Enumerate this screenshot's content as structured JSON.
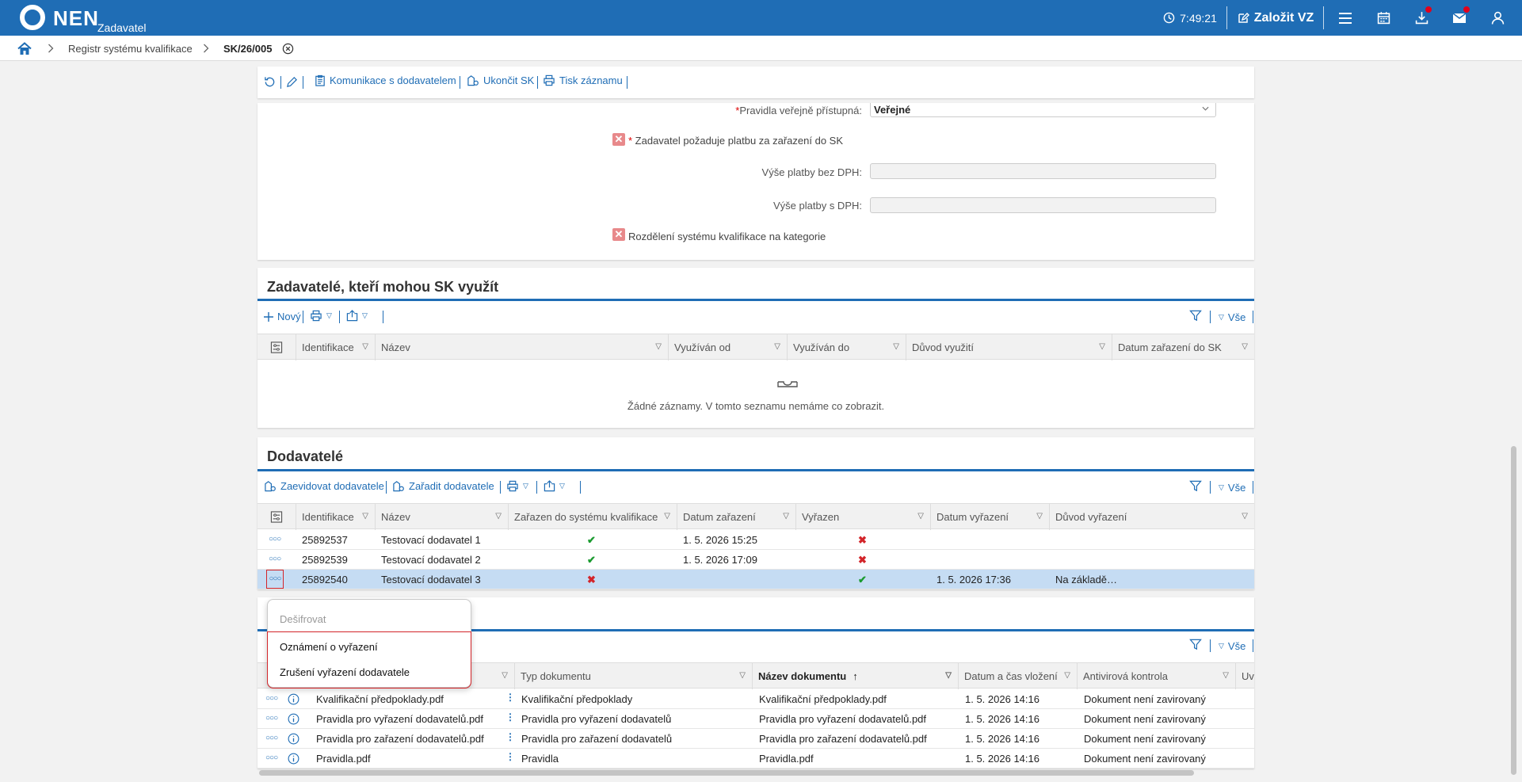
{
  "header": {
    "brand": "NEN",
    "role": "Zadavatel",
    "time": "7:49:21",
    "create_label": "Založit VZ"
  },
  "breadcrumb": {
    "item1": "Registr systému kvalifikace",
    "item2": "SK/26/005"
  },
  "toolbar": {
    "communication": "Komunikace s dodavatelem",
    "end": "Ukončit SK",
    "print": "Tisk záznamu"
  },
  "form": {
    "rules_public_label": "Pravidla veřejně přístupná:",
    "rules_public_value": "Veřejné",
    "payment_required_label": "Zadavatel požaduje platbu za zařazení do SK",
    "fee_without_vat_label": "Výše platby bez DPH:",
    "fee_with_vat_label": "Výše platby s DPH:",
    "categories_label": "Rozdělení systému kvalifikace na kategorie"
  },
  "contracting": {
    "title": "Zadavatelé, kteří mohou SK využít",
    "new_label": "Nový",
    "all_label": "Vše",
    "columns": [
      "Identifikace",
      "Název",
      "Využíván od",
      "Využíván do",
      "Důvod využití",
      "Datum zařazení do SK"
    ],
    "empty_text": "Žádné záznamy. V tomto seznamu nemáme co zobrazit."
  },
  "suppliers": {
    "title": "Dodavatelé",
    "register_label": "Zaevidovat dodavatele",
    "assign_label": "Zařadit dodavatele",
    "all_label": "Vše",
    "columns": [
      "Identifikace",
      "Název",
      "Zařazen do systému kvalifikace",
      "Datum zařazení",
      "Vyřazen",
      "Datum vyřazení",
      "Důvod vyřazení"
    ],
    "rows": [
      {
        "id": "25892537",
        "name": "Testovací dodavatel 1",
        "included": "✔",
        "date_in": "1. 5. 2026 15:25",
        "excluded": "✖",
        "date_out": "",
        "reason": ""
      },
      {
        "id": "25892539",
        "name": "Testovací dodavatel 2",
        "included": "✔",
        "date_in": "1. 5. 2026 17:09",
        "excluded": "✖",
        "date_out": "",
        "reason": ""
      },
      {
        "id": "25892540",
        "name": "Testovací dodavatel 3",
        "included": "✖",
        "date_in": "",
        "excluded": "✔",
        "date_out": "1. 5. 2026 17:36",
        "reason": "Na základě…"
      }
    ]
  },
  "context_menu": {
    "disabled": "Dešifrovat",
    "item1": "Oznámení o vyřazení",
    "item2": "Zrušení vyřazení dodavatele"
  },
  "documents": {
    "all_label": "Vše",
    "columns": [
      "Typ dokumentu",
      "Název dokumentu",
      "Datum a čas vložení",
      "Antivirová kontrola",
      "Uv"
    ],
    "rows": [
      {
        "file": "Kvalifikační předpoklady.pdf",
        "type": "Kvalifikační předpoklady",
        "name": "Kvalifikační předpoklady.pdf",
        "date": "1. 5. 2026 14:16",
        "av": "Dokument není zavirovaný"
      },
      {
        "file": "Pravidla pro vyřazení dodavatelů.pdf",
        "type": "Pravidla pro vyřazení dodavatelů",
        "name": "Pravidla pro vyřazení dodavatelů.pdf",
        "date": "1. 5. 2026 14:16",
        "av": "Dokument není zavirovaný"
      },
      {
        "file": "Pravidla pro zařazení dodavatelů.pdf",
        "type": "Pravidla pro zařazení dodavatelů",
        "name": "Pravidla pro zařazení dodavatelů.pdf",
        "date": "1. 5. 2026 14:16",
        "av": "Dokument není zavirovaný"
      },
      {
        "file": "Pravidla.pdf",
        "type": "Pravidla",
        "name": "Pravidla.pdf",
        "date": "1. 5. 2026 14:16",
        "av": "Dokument není zavirovaný"
      }
    ]
  },
  "colors": {
    "primary": "#1f6db5",
    "selected_row": "#c5dcf3",
    "ok": "#1b9b30",
    "error": "#d3252a"
  }
}
